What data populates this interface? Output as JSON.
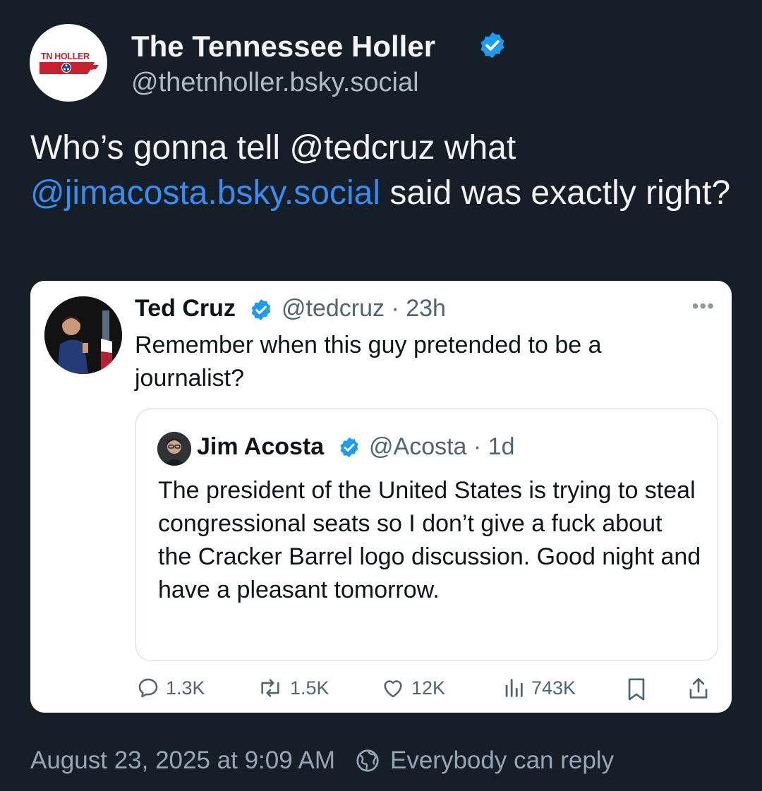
{
  "post": {
    "avatar_text": "TN HOLLER",
    "author_name": "The Tennessee Holler",
    "author_handle": "@thetnholler.bsky.social",
    "text_part1": "Who’s gonna tell @tedcruz what ",
    "text_mention": "@jimacosta.bsky.social",
    "text_part2": "  said was exactly right?",
    "timestamp": "August 23, 2025 at 9:09 AM",
    "reply_setting": "Everybody can reply"
  },
  "embed": {
    "author_name": "Ted Cruz",
    "author_meta": "@tedcruz · 23h",
    "more": "•••",
    "text": "Remember when this guy pretended to be a journalist?",
    "quote": {
      "author_name": "Jim Acosta",
      "author_meta": "@Acosta · 1d",
      "text": "The president of the United States is trying to steal congressional seats so I don’t give a fuck about the Cracker Barrel logo discussion. Good night and have a pleasant tomorrow."
    },
    "stats": {
      "replies": "1.3K",
      "reposts": "1.5K",
      "likes": "12K",
      "views": "743K"
    }
  },
  "colors": {
    "background": "#161e27",
    "mention": "#3b8cf0",
    "verified": "#1d9bf0",
    "holler_red": "#c8202f",
    "holler_blue": "#1f3f8f"
  }
}
